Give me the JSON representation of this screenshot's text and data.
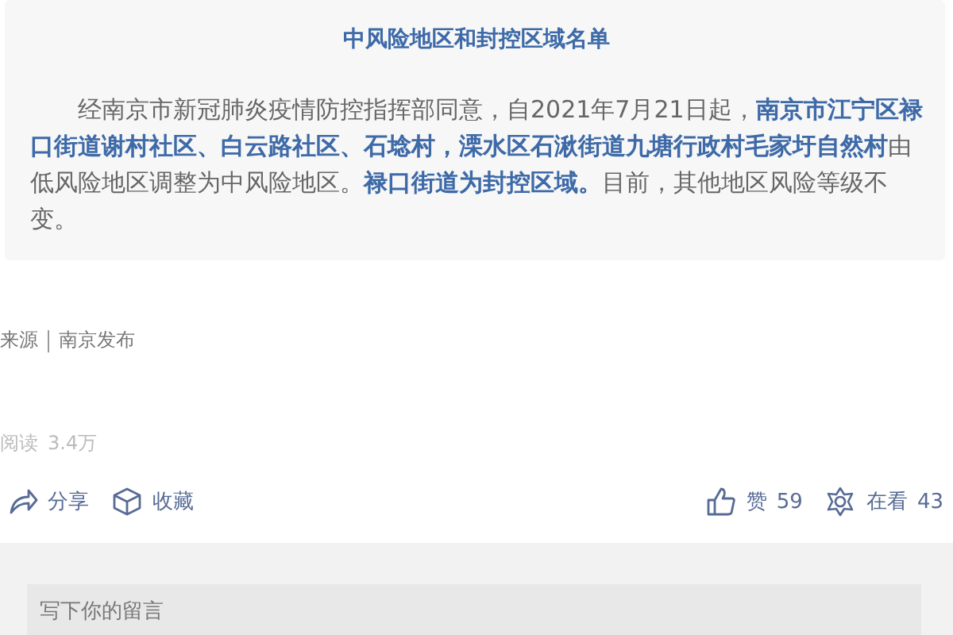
{
  "article": {
    "title": "中风险地区和封控区域名单",
    "paragraph": "经南京市新冠肺炎疫情防控指挥部同意，自2021年7月21日起，**南京市江宁区禄口街道谢村社区、白云路社区、石埝村，溧水区石湫街道九塘行政村毛家圩自然村**由低风险地区调整为中风险地区。**禄口街道为封控区域。**目前，其他地区风险等级不变。"
  },
  "source": {
    "label": "来源",
    "name": "南京发布"
  },
  "read_count": {
    "label": "阅读",
    "value": "3.4万"
  },
  "actions": [
    {
      "kind": "share",
      "label": "分享"
    },
    {
      "kind": "favorite",
      "label": "收藏"
    },
    {
      "kind": "like",
      "label": "赞",
      "count": "59"
    },
    {
      "kind": "watching",
      "label": "在看",
      "count": "43"
    }
  ],
  "comment": {
    "placeholder": "写下你的留言"
  }
}
